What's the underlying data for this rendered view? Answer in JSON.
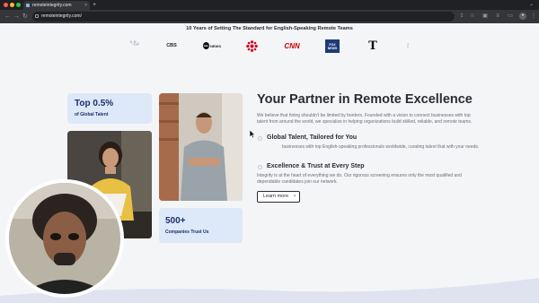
{
  "browser": {
    "tab_title": "remoteintegrity.com",
    "url": "remoteintegrity.com/",
    "new_tab_symbol": "+",
    "tab_close_symbol": "×"
  },
  "page": {
    "tagline": "10 Years of Setting The Standard for English-Speaking Remote Teams",
    "logos": [
      "CBS",
      "abc NEWS",
      "CBC",
      "CNN",
      "FOX NEWS",
      "T",
      "NYPost"
    ],
    "stat_top": {
      "value": "Top 0.5%",
      "label": "of Global Talent"
    },
    "stat_bottom": {
      "value": "500+",
      "label": "Companies Trust Us"
    },
    "heading": "Your Partner in Remote Excellence",
    "intro": "We believe that hiring shouldn't be limited by borders. Founded with a vision to connect businesses with top talent from around the world, we specialize in helping organizations build skilled, reliable, and remote teams.",
    "features": [
      {
        "title": "Global Talent, Tailored for You",
        "text": "businesses with top English-speaking professionals worldwide, curating talent that with your needs."
      },
      {
        "title": "Excellence & Trust at Every Step",
        "text": "Integrity is at the heart of everything we do. Our rigorous screening ensures only the most qualified and dependable candidates join our network."
      }
    ],
    "cta_label": "Learn more",
    "cta_arrow": "›"
  },
  "colors": {
    "accent": "#1d2f6a",
    "card_bg": "#dde8f8",
    "cnn_red": "#cc0000",
    "cbc_red": "#d5001f"
  }
}
